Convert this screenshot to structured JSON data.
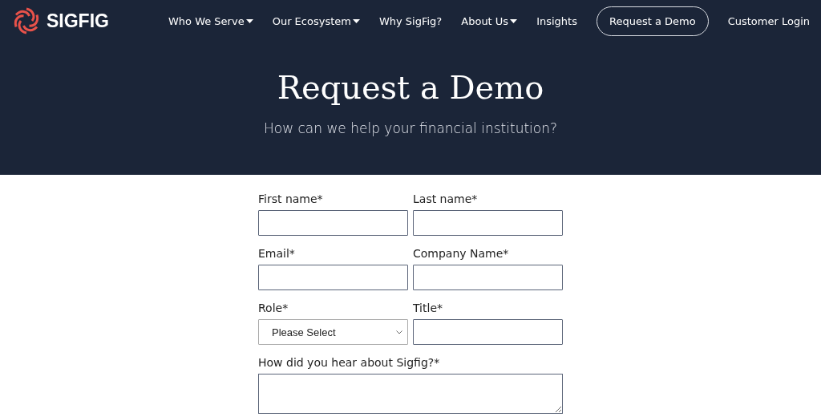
{
  "logo": {
    "text": "SIGFIG"
  },
  "nav": [
    {
      "label": "Who We Serve",
      "kind": "dropdown"
    },
    {
      "label": "Our Ecosystem",
      "kind": "dropdown"
    },
    {
      "label": "Why SigFig?",
      "kind": "link"
    },
    {
      "label": "About Us",
      "kind": "dropdown"
    },
    {
      "label": "Insights",
      "kind": "link"
    },
    {
      "label": "Request a Demo",
      "kind": "button"
    },
    {
      "label": "Customer Login",
      "kind": "link"
    }
  ],
  "hero": {
    "title": "Request a Demo",
    "subtitle": "How can we help your financial institution?"
  },
  "form": {
    "fields": [
      {
        "label": "First name*",
        "kind": "text"
      },
      {
        "label": "Last name*",
        "kind": "text"
      },
      {
        "label": "Email*",
        "kind": "text"
      },
      {
        "label": "Company Name*",
        "kind": "text"
      },
      {
        "label": "Role*",
        "kind": "select",
        "value": "Please Select"
      },
      {
        "label": "Title*",
        "kind": "text"
      },
      {
        "label": "How did you hear about Sigfig?*",
        "kind": "textarea"
      }
    ]
  }
}
